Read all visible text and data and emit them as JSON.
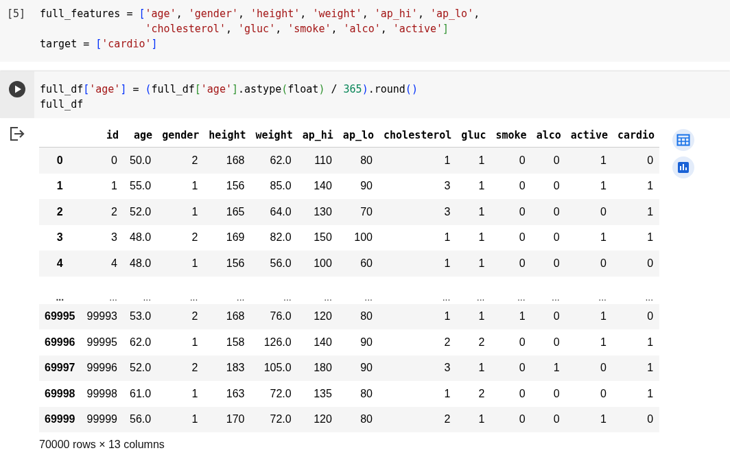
{
  "cells": [
    {
      "kind": "executed",
      "prompt": "[5]",
      "lines": [
        "full_features = ['age', 'gender', 'height', 'weight', 'ap_hi', 'ap_lo',",
        "                 'cholesterol', 'gluc', 'smoke', 'alco', 'active']",
        "target = ['cardio']"
      ]
    },
    {
      "kind": "run",
      "lines": [
        "full_df['age'] = (full_df['age'].astype(float) / 365).round()",
        "full_df"
      ],
      "output": {
        "columns": [
          "id",
          "age",
          "gender",
          "height",
          "weight",
          "ap_hi",
          "ap_lo",
          "cholesterol",
          "gluc",
          "smoke",
          "alco",
          "active",
          "cardio"
        ],
        "rows": [
          {
            "kind": "data",
            "index": "0",
            "cells": [
              "0",
              "50.0",
              "2",
              "168",
              "62.0",
              "110",
              "80",
              "1",
              "1",
              "0",
              "0",
              "1",
              "0"
            ]
          },
          {
            "kind": "data",
            "index": "1",
            "cells": [
              "1",
              "55.0",
              "1",
              "156",
              "85.0",
              "140",
              "90",
              "3",
              "1",
              "0",
              "0",
              "1",
              "1"
            ]
          },
          {
            "kind": "data",
            "index": "2",
            "cells": [
              "2",
              "52.0",
              "1",
              "165",
              "64.0",
              "130",
              "70",
              "3",
              "1",
              "0",
              "0",
              "0",
              "1"
            ]
          },
          {
            "kind": "data",
            "index": "3",
            "cells": [
              "3",
              "48.0",
              "2",
              "169",
              "82.0",
              "150",
              "100",
              "1",
              "1",
              "0",
              "0",
              "1",
              "1"
            ]
          },
          {
            "kind": "data",
            "index": "4",
            "cells": [
              "4",
              "48.0",
              "1",
              "156",
              "56.0",
              "100",
              "60",
              "1",
              "1",
              "0",
              "0",
              "0",
              "0"
            ]
          },
          {
            "kind": "ellipsis",
            "index": "...",
            "cells": [
              "...",
              "...",
              "...",
              "...",
              "...",
              "...",
              "...",
              "...",
              "...",
              "...",
              "...",
              "...",
              "..."
            ]
          },
          {
            "kind": "data",
            "index": "69995",
            "cells": [
              "99993",
              "53.0",
              "2",
              "168",
              "76.0",
              "120",
              "80",
              "1",
              "1",
              "1",
              "0",
              "1",
              "0"
            ]
          },
          {
            "kind": "data",
            "index": "69996",
            "cells": [
              "99995",
              "62.0",
              "1",
              "158",
              "126.0",
              "140",
              "90",
              "2",
              "2",
              "0",
              "0",
              "1",
              "1"
            ]
          },
          {
            "kind": "data",
            "index": "69997",
            "cells": [
              "99996",
              "52.0",
              "2",
              "183",
              "105.0",
              "180",
              "90",
              "3",
              "1",
              "0",
              "1",
              "0",
              "1"
            ]
          },
          {
            "kind": "data",
            "index": "69998",
            "cells": [
              "99998",
              "61.0",
              "1",
              "163",
              "72.0",
              "135",
              "80",
              "1",
              "2",
              "0",
              "0",
              "0",
              "1"
            ]
          },
          {
            "kind": "data",
            "index": "69999",
            "cells": [
              "99999",
              "56.0",
              "1",
              "170",
              "72.0",
              "120",
              "80",
              "2",
              "1",
              "0",
              "0",
              "1",
              "0"
            ]
          }
        ],
        "summary": "70000 rows × 13 columns"
      }
    }
  ]
}
